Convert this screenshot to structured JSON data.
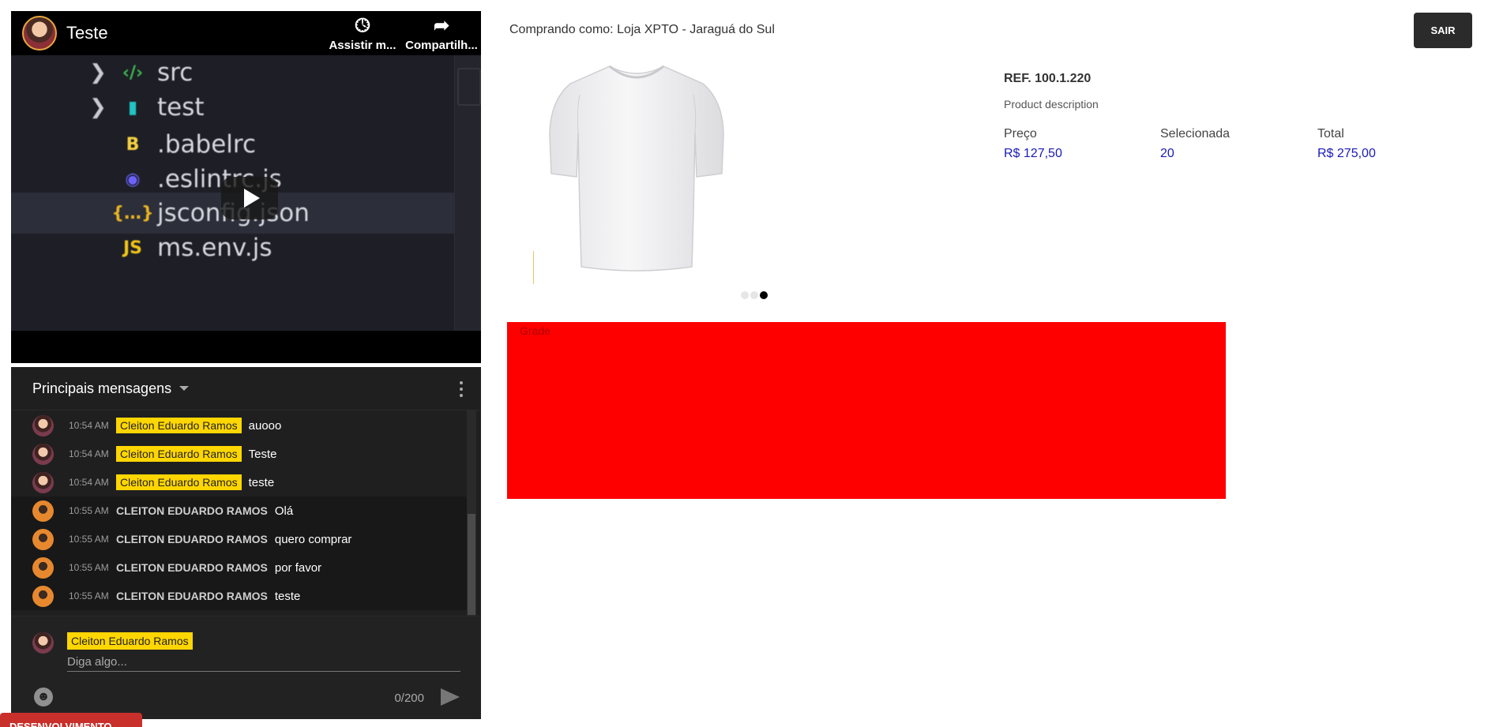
{
  "video": {
    "title": "Teste",
    "actions": [
      {
        "label": "Assistir m...",
        "icon": "clock-icon"
      },
      {
        "label": "Compartilh...",
        "icon": "share-icon"
      }
    ],
    "frame_rows": [
      {
        "chevron": "❯",
        "icon": "folder-src-icon",
        "icon_glyph": "‹/›",
        "icon_color": "#3fb950",
        "label": "src"
      },
      {
        "chevron": "❯",
        "icon": "folder-test-icon",
        "icon_glyph": "▮",
        "icon_color": "#22c3c3",
        "label": "test"
      },
      {
        "chevron": "",
        "icon": "babel-icon",
        "icon_glyph": "B",
        "icon_color": "#f5d142",
        "label": ".babelrc"
      },
      {
        "chevron": "",
        "icon": "eslint-icon",
        "icon_glyph": "◉",
        "icon_color": "#6c63ff",
        "label": ".eslintrc.js"
      },
      {
        "chevron": "",
        "icon": "json-icon",
        "icon_glyph": "{…}",
        "icon_color": "#e9b422",
        "label": "jsconfig.json"
      },
      {
        "chevron": "",
        "icon": "js-icon",
        "icon_glyph": "JS",
        "icon_color": "#f0c419",
        "label": "ms.env.js"
      }
    ]
  },
  "chat": {
    "title": "Principais mensagens",
    "messages": [
      {
        "time": "10:54 AM",
        "author": "Cleiton Eduardo Ramos",
        "text": "auooo",
        "owner": true
      },
      {
        "time": "10:54 AM",
        "author": "Cleiton Eduardo Ramos",
        "text": "Teste",
        "owner": true
      },
      {
        "time": "10:54 AM",
        "author": "Cleiton Eduardo Ramos",
        "text": "teste",
        "owner": true
      },
      {
        "time": "10:55 AM",
        "author": "CLEITON EDUARDO RAMOS",
        "text": "Olá",
        "owner": false
      },
      {
        "time": "10:55 AM",
        "author": "CLEITON EDUARDO RAMOS",
        "text": "quero comprar",
        "owner": false
      },
      {
        "time": "10:55 AM",
        "author": "CLEITON EDUARDO RAMOS",
        "text": "por favor",
        "owner": false
      },
      {
        "time": "10:55 AM",
        "author": "CLEITON EDUARDO RAMOS",
        "text": "teste",
        "owner": false
      }
    ],
    "input": {
      "author": "Cleiton Eduardo Ramos",
      "placeholder": "Diga algo...",
      "char_count": "0/200"
    }
  },
  "dev_badge": "DESENVOLVIMENTO",
  "store": {
    "buyer_label": "Comprando como: Loja XPTO - Jaraguá do Sul",
    "logout_label": "SAIR"
  },
  "product": {
    "ref": "REF. 100.1.220",
    "description": "Product description",
    "price_label": "Preço",
    "price_value": "R$ 127,50",
    "selected_label": "Selecionada",
    "selected_value": "20",
    "total_label": "Total",
    "total_value": "R$ 275,00",
    "carousel_total": 3,
    "carousel_active": 3
  },
  "grade": {
    "label": "Grade",
    "color": "#ff0000"
  }
}
